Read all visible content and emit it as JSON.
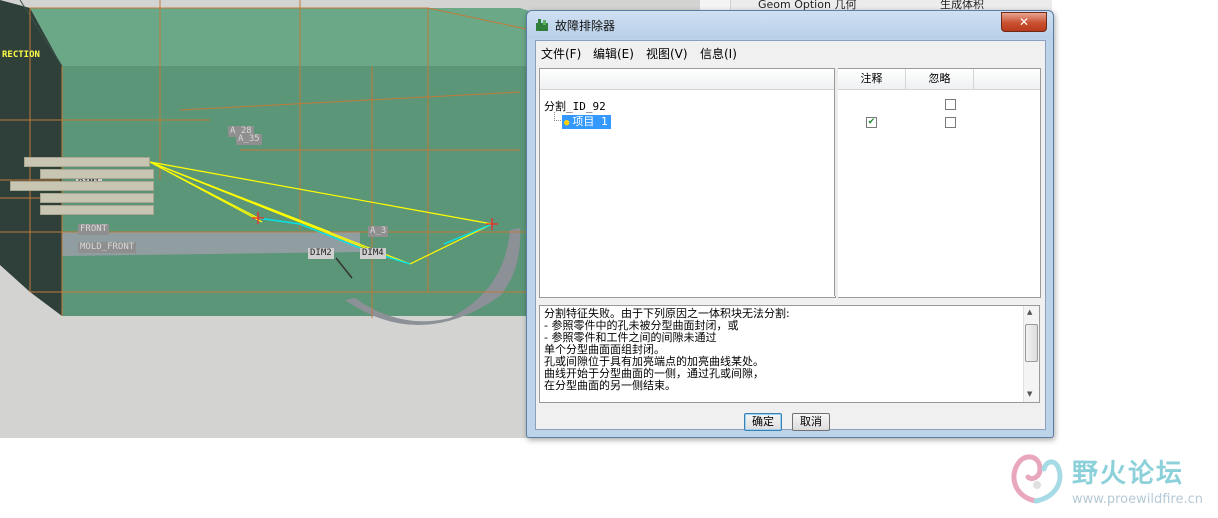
{
  "background_window": {
    "header_cells": [
      "Geom Option 几何",
      "生成体积块"
    ]
  },
  "viewport": {
    "labels": {
      "rection": "RECTION",
      "front": "FRONT",
      "mold_front": "MOLD_FRONT",
      "a28": "A_28",
      "a35": "A_35",
      "a3": "A_3",
      "dim1": "DIM1",
      "dim2": "DIM2",
      "dim4": "DIM4"
    },
    "colors": {
      "solid": "#5c9678",
      "dark_face": "#2e4039",
      "wire": "#c07a3a",
      "yellow_curve": "#ffff00",
      "cyan_curve": "#00e6e6"
    }
  },
  "dialog": {
    "title": "故障排除器",
    "title_icon": "troubleshooter-icon",
    "close_label": "✕",
    "menu": [
      "文件(F)",
      "编辑(E)",
      "视图(V)",
      "信息(I)"
    ],
    "tree": {
      "root": "分割_ID_92",
      "child": "项目 1"
    },
    "columns": [
      "注释",
      "忽略"
    ],
    "rows": [
      {
        "note": false,
        "ignore": false
      },
      {
        "note": true,
        "ignore": false
      }
    ],
    "message_lines": [
      "分割特征失败。由于下列原因之一体积块无法分割:",
      " - 参照零件中的孔未被分型曲面封闭，或",
      " - 参照零件和工件之间的间隙未通过",
      "单个分型曲面面组封闭。",
      "孔或间隙位于具有加亮端点的加亮曲线某处。",
      "曲线开始于分型曲面的一侧，通过孔或间隙，",
      "在分型曲面的另一侧结束。"
    ],
    "buttons": {
      "ok": "确定",
      "cancel": "取消"
    }
  },
  "watermark": {
    "title": "野火论坛",
    "url": "www.proewildfire.cn"
  }
}
